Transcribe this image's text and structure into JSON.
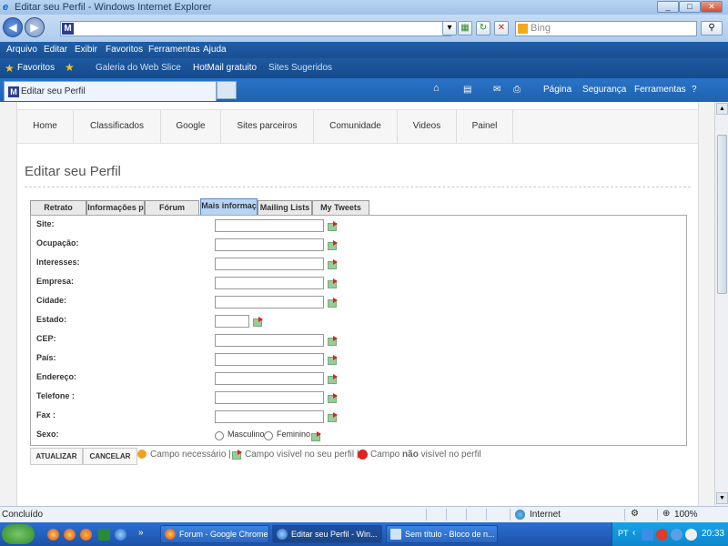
{
  "window": {
    "title": "Editar seu Perfil - Windows Internet Explorer",
    "controls": [
      "_",
      "□",
      "✕"
    ]
  },
  "addressbar": {
    "url": "",
    "search_placeholder": "Bing"
  },
  "menubar": [
    "Arquivo",
    "Editar",
    "Exibir",
    "Favoritos",
    "Ferramentas",
    "Ajuda"
  ],
  "favbar": {
    "favorites": "Favoritos",
    "items": [
      "Galeria do Web Slice",
      "HotMail gratuito",
      "Sites Sugeridos"
    ]
  },
  "tab": {
    "title": "Editar seu Perfil"
  },
  "commandbar": [
    "Página",
    "Segurança",
    "Ferramentas"
  ],
  "site": {
    "nav": [
      "Home",
      "Classificados",
      "Google",
      "Sites parceiros",
      "Comunidade",
      "Videos",
      "Painel"
    ],
    "page_title": "Editar seu Perfil",
    "tabs": [
      "Retrato",
      "Informações p",
      "Fórum",
      "Mais informaç",
      "Mailing Lists",
      "My Tweets"
    ],
    "fields": [
      "Site:",
      "Ocupação:",
      "Interesses:",
      "Empresa:",
      "Cidade:",
      "Estado:",
      "CEP:",
      "País:",
      "Endereço:",
      "Telefone :",
      "Fax :"
    ],
    "sex_label": "Sexo:",
    "sex_options": [
      "Masculino",
      "Feminino"
    ],
    "buttons": {
      "update": "ATUALIZAR",
      "cancel": "CANCELAR"
    },
    "legend": {
      "required": "Campo necessário |",
      "visible": "Campo visível no seu perfil |",
      "not_visible_prefix": "Campo",
      "not_visible_bold": "não",
      "not_visible_suffix": "visível no perfil"
    }
  },
  "status": {
    "text": "Concluído",
    "zone": "Internet",
    "zoom": "100%"
  },
  "taskbar": {
    "tasks": [
      "Forum - Google Chrome",
      "Editar seu Perfil - Win...",
      "Sem título - Bloco de n..."
    ],
    "lang": "PT",
    "time": "20:33"
  }
}
